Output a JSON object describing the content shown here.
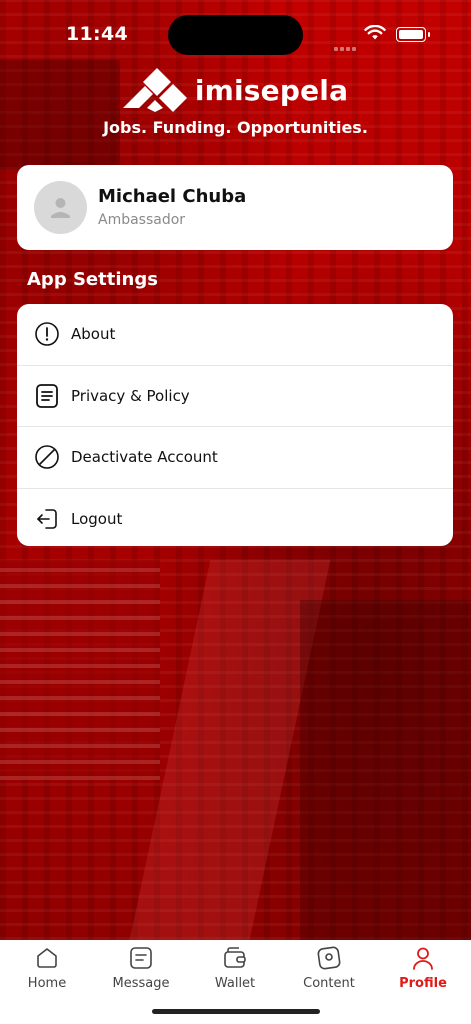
{
  "status": {
    "time": "11:44"
  },
  "brand": {
    "name": "imisepela",
    "tagline": "Jobs. Funding. Opportunities."
  },
  "profile": {
    "name": "Michael Chuba",
    "role": "Ambassador"
  },
  "settings": {
    "title": "App Settings",
    "items": [
      {
        "label": "About",
        "icon": "info-icon"
      },
      {
        "label": "Privacy & Policy",
        "icon": "document-icon"
      },
      {
        "label": "Deactivate Account",
        "icon": "block-icon"
      },
      {
        "label": "Logout",
        "icon": "logout-icon"
      }
    ]
  },
  "tabs": [
    {
      "label": "Home",
      "icon": "home-icon",
      "active": false
    },
    {
      "label": "Message",
      "icon": "message-icon",
      "active": false
    },
    {
      "label": "Wallet",
      "icon": "wallet-icon",
      "active": false
    },
    {
      "label": "Content",
      "icon": "content-icon",
      "active": false
    },
    {
      "label": "Profile",
      "icon": "profile-icon",
      "active": true
    }
  ],
  "colors": {
    "accent": "#e01919",
    "background": "#b40000",
    "card": "#ffffff"
  }
}
